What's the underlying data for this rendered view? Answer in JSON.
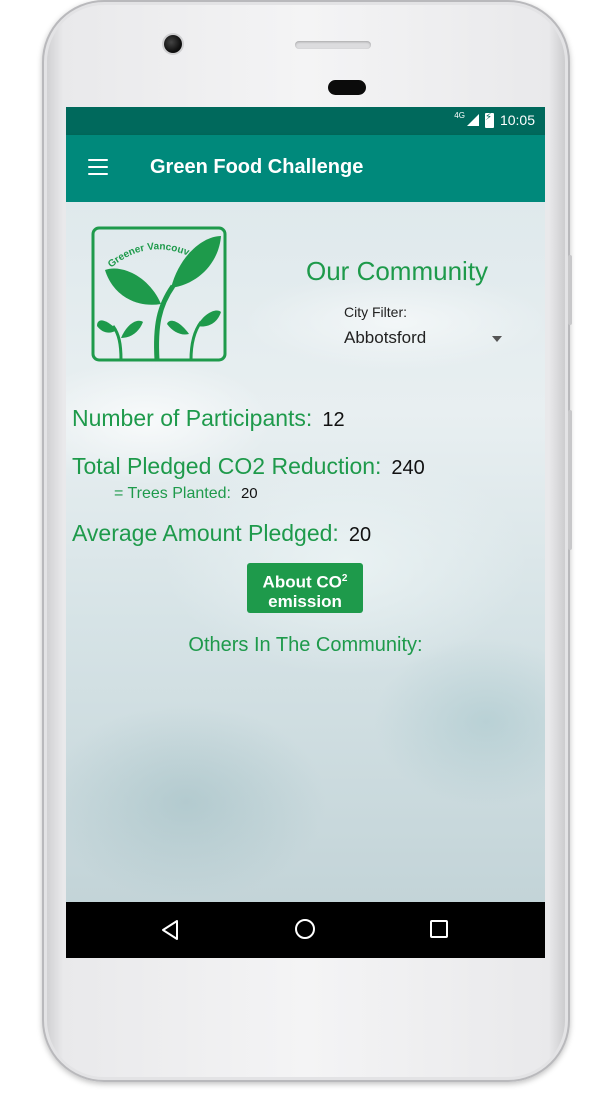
{
  "status_bar": {
    "network": "4G",
    "time": "10:05"
  },
  "app_bar": {
    "title": "Green Food Challenge",
    "menu_icon": "hamburger-menu-icon"
  },
  "logo": {
    "text": "Greener Vancouver",
    "icon": "sprouting-plants-logo"
  },
  "community": {
    "title": "Our Community",
    "city_filter_label": "City Filter:",
    "city_selected": "Abbotsford"
  },
  "stats": {
    "participants_label": "Number of Participants:",
    "participants_value": "12",
    "co2_label": "Total Pledged CO2 Reduction:",
    "co2_value": "240",
    "trees_label": "= Trees Planted:",
    "trees_value": "20",
    "average_label": "Average Amount Pledged:",
    "average_value": "20"
  },
  "about_button": {
    "line1": "About CO",
    "sup": "2",
    "line2": "emission"
  },
  "others_label": "Others In The Community:",
  "nav": {
    "back_icon": "back-triangle-icon",
    "home_icon": "home-circle-icon",
    "recent_icon": "recent-apps-square-icon"
  },
  "colors": {
    "status_bar": "#00695c",
    "app_bar": "#00897b",
    "accent_green": "#1e9a4b"
  }
}
